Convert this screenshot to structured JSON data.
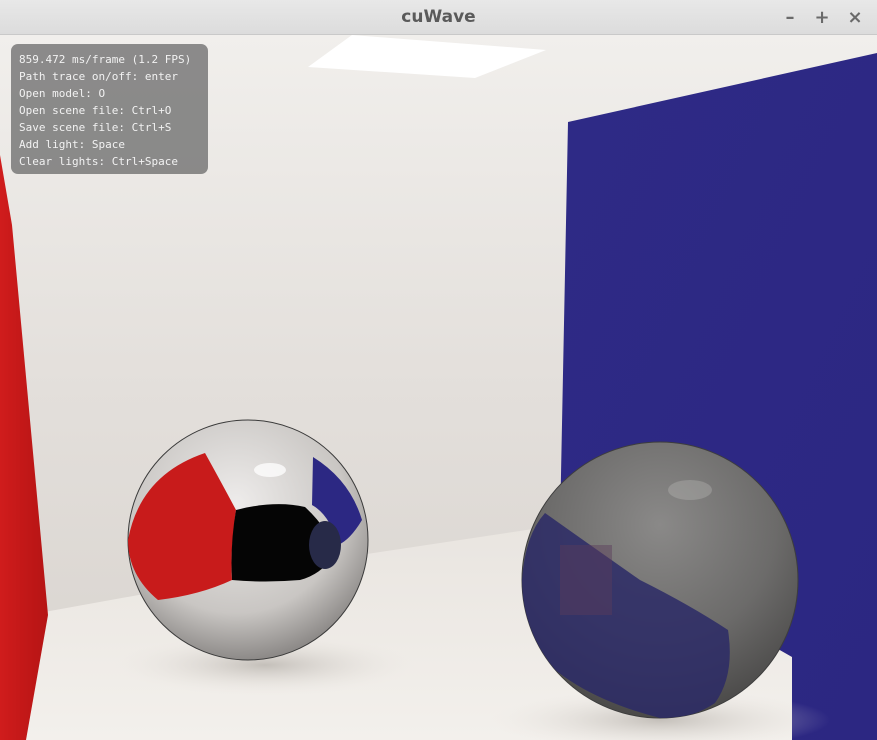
{
  "window": {
    "title": "cuWave",
    "controls": {
      "minimize": "–",
      "maximize": "+",
      "close": "×"
    }
  },
  "hud": {
    "lines": [
      "859.472 ms/frame (1.2 FPS)",
      "Path trace on/off: enter",
      "Open model: O",
      "Open scene file: Ctrl+O",
      "Save scene file: Ctrl+S",
      "Add light: Space",
      "Clear lights: Ctrl+Space"
    ]
  },
  "scene": {
    "colors": {
      "back_wall": "#e3dfdb",
      "floor": "#f3f0ec",
      "left_wall": "#d01c1c",
      "right_wall": "#2c2782",
      "ceiling_light": "#ffffff",
      "mirror_sphere": "#c9c6c3",
      "glossy_sphere": "#6c6b6a"
    }
  }
}
